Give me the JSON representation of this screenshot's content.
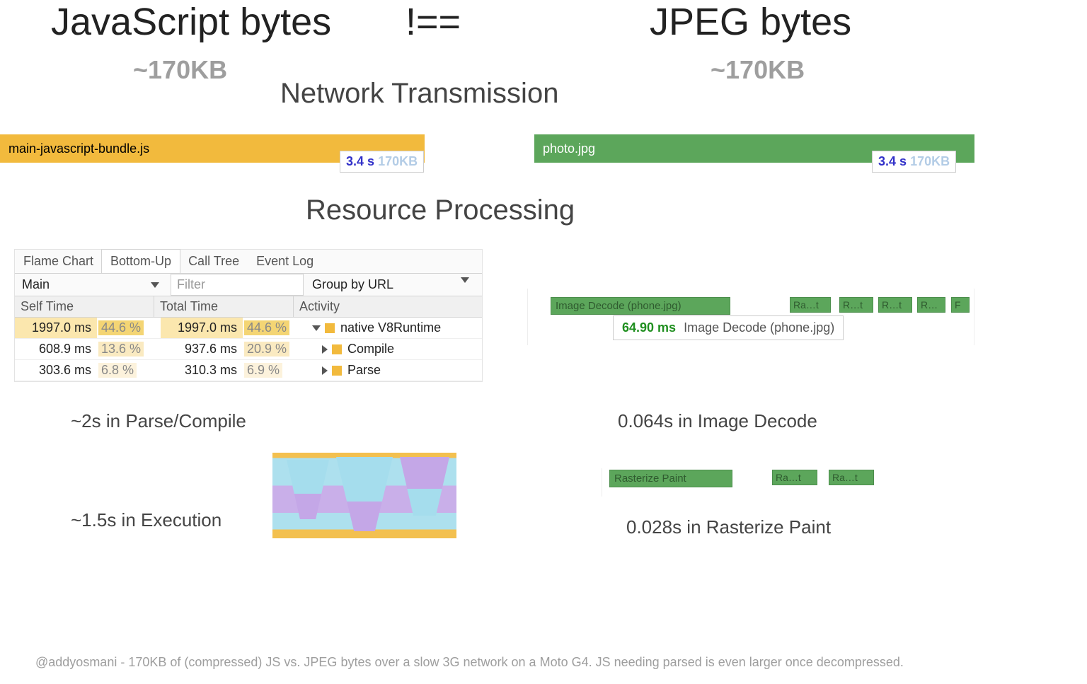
{
  "slide": {
    "left_title": "JavaScript bytes",
    "right_title": "JPEG bytes",
    "not_equal": "!==",
    "left_size": "~170KB",
    "right_size": "~170KB",
    "network_heading": "Network Transmission",
    "resource_heading": "Resource Processing"
  },
  "network": {
    "left": {
      "file": "main-javascript-bundle.js",
      "time": "3.4 s",
      "size": "170KB"
    },
    "right": {
      "file": "photo.jpg",
      "time": "3.4 s",
      "size": "170KB"
    }
  },
  "devtools": {
    "tabs": [
      "Flame Chart",
      "Bottom-Up",
      "Call Tree",
      "Event Log"
    ],
    "active_tab": 1,
    "main_select": "Main",
    "filter_placeholder": "Filter",
    "group_by": "Group by URL",
    "headers": [
      "Self Time",
      "Total Time",
      "Activity"
    ],
    "rows": [
      {
        "self": "1997.0 ms",
        "self_pct": "44.6 %",
        "total": "1997.0 ms",
        "total_pct": "44.6 %",
        "arrow": "down",
        "activity": "native V8Runtime"
      },
      {
        "self": "608.9 ms",
        "self_pct": "13.6 %",
        "total": "937.6 ms",
        "total_pct": "20.9 %",
        "arrow": "right",
        "activity": "Compile"
      },
      {
        "self": "303.6 ms",
        "self_pct": "6.8 %",
        "total": "310.3 ms",
        "total_pct": "6.9 %",
        "arrow": "right",
        "activity": "Parse"
      }
    ]
  },
  "image_timeline": {
    "main_block": "Image Decode (phone.jpg)",
    "tooltip_time": "64.90 ms",
    "tooltip_label": "Image Decode (phone.jpg)",
    "raster_short": "Ra…t",
    "rightmost_short": "R…t",
    "rasterize_full": "Rasterize Paint"
  },
  "summaries": {
    "parse_compile": "~2s in Parse/Compile",
    "execution": "~1.5s in Execution",
    "image_decode": "0.064s in Image Decode",
    "rasterize": "0.028s in Rasterize Paint"
  },
  "footer": "@addyosmani - 170KB of (compressed) JS vs. JPEG bytes over a slow 3G network on a Moto G4. JS needing parsed is even larger once decompressed."
}
